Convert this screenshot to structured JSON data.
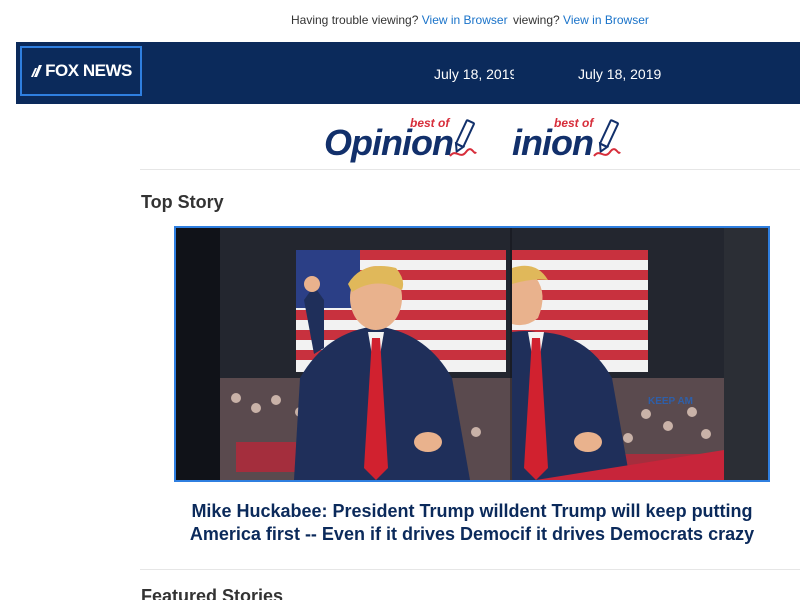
{
  "trouble_bar": {
    "prefix": "Having trouble viewing?",
    "link": "View in Browser",
    "prefix_dup": "viewing?",
    "link_dup": "View in Browser"
  },
  "header": {
    "logo": "FOX NEWS",
    "date": "July 18, 2019",
    "date_dup": "July 18, 2019"
  },
  "opinion_logo": {
    "word": "Opinion",
    "word_dup": "inion",
    "best_of": "best of"
  },
  "top_story": {
    "section_title": "Top Story",
    "headline_line1": "Mike Huckabee: President Trump will",
    "headline_line1_dup": "dent Trump will keep putting",
    "headline_line2": "America first -- Even if it drives Democ",
    "headline_line2_dup": "if it drives Democrats crazy"
  },
  "featured": {
    "section_title": "Featured Stories"
  },
  "colors": {
    "brand_navy": "#0b2a5b",
    "accent_blue": "#2f7fe0",
    "link_blue": "#1a73c9",
    "opinion_red": "#d72d3a"
  }
}
